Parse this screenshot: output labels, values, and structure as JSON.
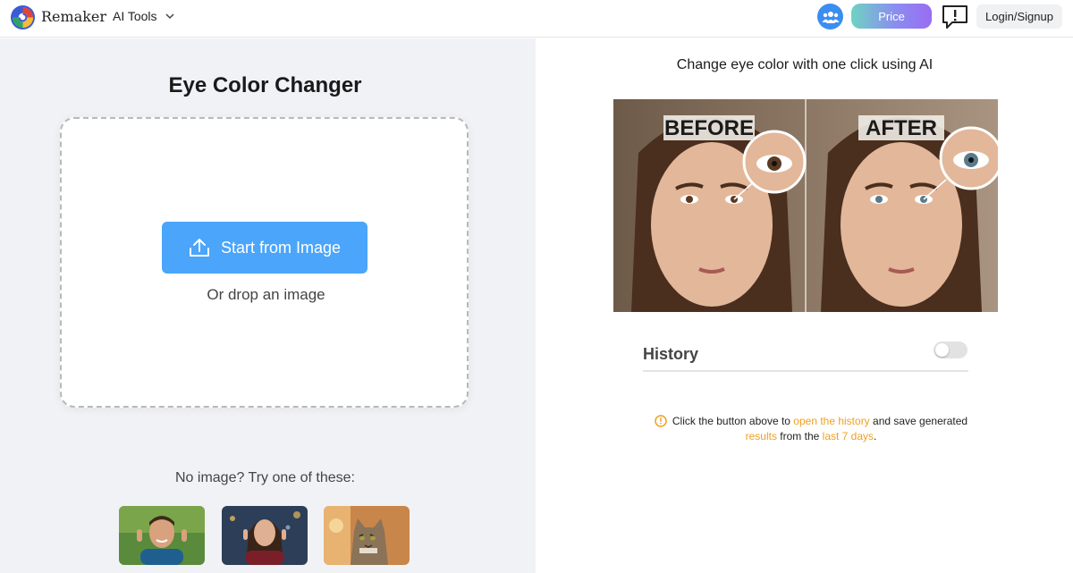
{
  "header": {
    "brand": "Remaker",
    "tools_label": "AI Tools",
    "price_label": "Price",
    "login_label": "Login/Signup",
    "icons": {
      "logo": "remaker-logo",
      "tools_chevron": "chevron-down-icon",
      "community": "community-icon",
      "feedback": "feedback-icon"
    }
  },
  "left": {
    "title": "Eye Color Changer",
    "upload_label": "Start from Image",
    "upload_icon": "upload-icon",
    "drop_text": "Or drop an image",
    "try_text": "No image? Try one of these:",
    "samples": [
      "man pointing at eyes",
      "woman pointing at eyes",
      "cat"
    ]
  },
  "right": {
    "subtitle": "Change eye color with one click using AI",
    "demo_labels": {
      "before": "BEFORE",
      "after": "AFTER"
    },
    "history": {
      "label": "History",
      "toggle_on": false,
      "hint_pre": "Click the button above to ",
      "hint_link1": "open the history",
      "hint_mid": " and save generated ",
      "hint_link2": "results",
      "hint_mid2": " from the ",
      "hint_link3": "last 7 days",
      "hint_post": "."
    }
  },
  "colors": {
    "accent_blue": "#4aa5fb",
    "highlight_orange": "#f0a020",
    "panel_gray": "#f1f2f5"
  }
}
